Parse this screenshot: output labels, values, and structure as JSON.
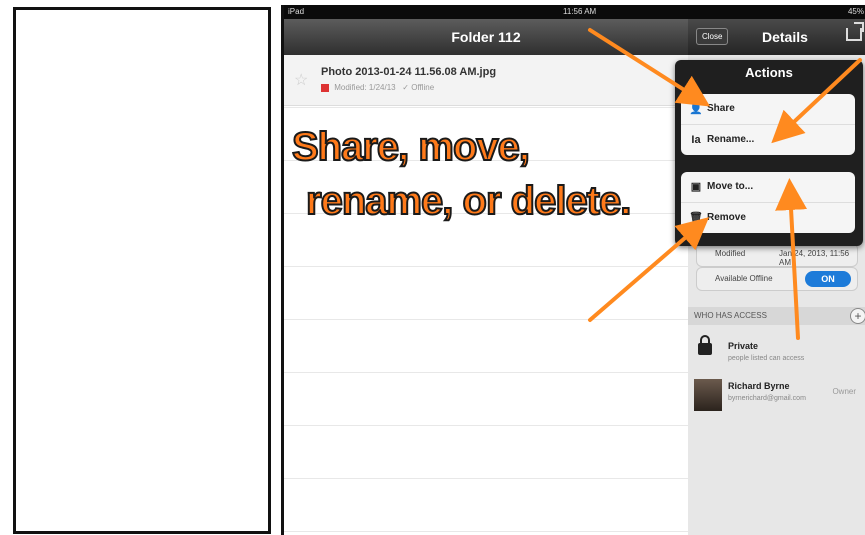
{
  "status_bar": {
    "carrier": "iPad",
    "time": "11:56 AM",
    "battery": "45%"
  },
  "nav": {
    "title": "Folder 112"
  },
  "file": {
    "name": "Photo 2013-01-24 11.56.08 AM.jpg",
    "modified": "Modified: 1/24/13",
    "offline": "Offline"
  },
  "overlay": {
    "line1": "Share, move,",
    "line2": "rename, or delete."
  },
  "details": {
    "close": "Close",
    "title": "Details"
  },
  "actions": {
    "title": "Actions",
    "items": [
      "Share",
      "Rename...",
      "Move to...",
      "Remove"
    ]
  },
  "side": {
    "modified_label": "Modified",
    "modified_value": "Jan 24, 2013, 11:56 AM",
    "available_offline": "Available Offline",
    "toggle": "ON",
    "who_has_access": "WHO HAS ACCESS"
  },
  "people": [
    {
      "name": "Private",
      "sub": "people listed can access"
    },
    {
      "name": "Richard Byrne",
      "sub": "byrnerichard@gmail.com",
      "role": "Owner"
    }
  ],
  "colors": {
    "accent": "#ff7a1a",
    "toggle": "#1d7bd9"
  }
}
